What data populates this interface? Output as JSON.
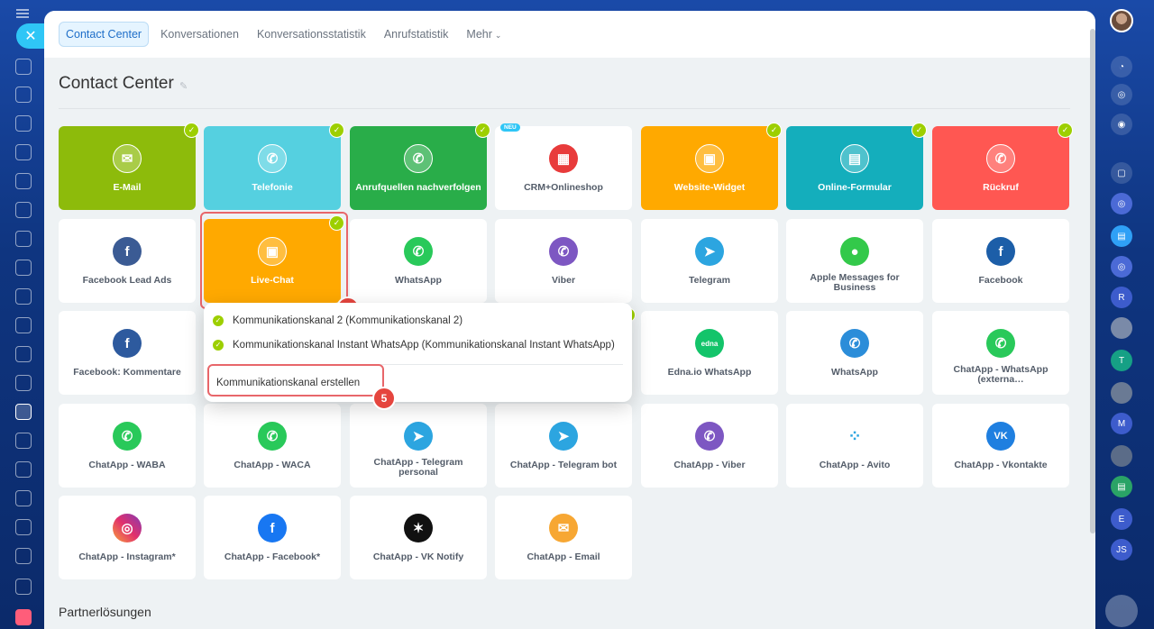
{
  "tabs": [
    {
      "label": "Contact Center"
    },
    {
      "label": "Konversationen"
    },
    {
      "label": "Konversationsstatistik"
    },
    {
      "label": "Anrufstatistik"
    },
    {
      "label": "Mehr"
    }
  ],
  "page_title": "Contact Center",
  "tiles": {
    "email": {
      "label": "E-Mail",
      "color": "#8dbb0b"
    },
    "telefonie": {
      "label": "Telefonie",
      "color": "#55d0e0"
    },
    "anrufquellen": {
      "label": "Anrufquellen nachverfolgen",
      "color": "#29ad49"
    },
    "crm": {
      "label": "CRM+Onlineshop",
      "badge": "NEU"
    },
    "website": {
      "label": "Website-Widget",
      "color": "#ffa900"
    },
    "formular": {
      "label": "Online-Formular",
      "color": "#14aebc"
    },
    "rueckruf": {
      "label": "Rückruf",
      "color": "#ff5752"
    },
    "fb_lead": {
      "label": "Facebook Lead Ads"
    },
    "livechat": {
      "label": "Live-Chat",
      "color": "#ffa900"
    },
    "whatsapp1": {
      "label": "WhatsApp"
    },
    "viber1": {
      "label": "Viber"
    },
    "telegram1": {
      "label": "Telegram"
    },
    "apple": {
      "label": "Apple Messages for Business"
    },
    "facebook1": {
      "label": "Facebook"
    },
    "fb_comments": {
      "label": "Facebook: Kommentare"
    },
    "edna": {
      "label": "Edna.io WhatsApp"
    },
    "whatsapp2": {
      "label": "WhatsApp"
    },
    "chatapp_wa_ext": {
      "label": "ChatApp - WhatsApp (externa…"
    },
    "chatapp_waba": {
      "label": "ChatApp - WABA"
    },
    "chatapp_waca": {
      "label": "ChatApp - WACA"
    },
    "chatapp_tg_personal": {
      "label": "ChatApp - Telegram personal"
    },
    "chatapp_tg_bot": {
      "label": "ChatApp - Telegram bot"
    },
    "chatapp_viber": {
      "label": "ChatApp - Viber"
    },
    "chatapp_avito": {
      "label": "ChatApp - Avito"
    },
    "chatapp_vk": {
      "label": "ChatApp - Vkontakte"
    },
    "chatapp_insta": {
      "label": "ChatApp - Instagram*"
    },
    "chatapp_fb": {
      "label": "ChatApp - Facebook*"
    },
    "chatapp_vknotify": {
      "label": "ChatApp - VK Notify"
    },
    "chatapp_email": {
      "label": "ChatApp - Email"
    }
  },
  "popup": {
    "items": [
      {
        "label": "Kommunikationskanal 2 (Kommunikationskanal 2)"
      },
      {
        "label": "Kommunikationskanal Instant WhatsApp (Kommunikationskanal Instant WhatsApp)"
      }
    ],
    "create_label": "Kommunikationskanal erstellen"
  },
  "steps": {
    "four": "4",
    "five": "5"
  },
  "section_partner": "Partnerlösungen",
  "rail_avatars": [
    "R",
    "T",
    "M",
    "E",
    "JS"
  ]
}
